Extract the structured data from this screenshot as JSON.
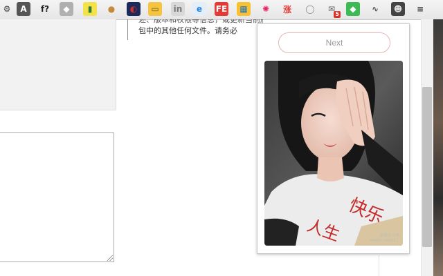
{
  "toolbar": {
    "icons": [
      {
        "name": "gear-icon",
        "glyph": "⚙",
        "color": "#444",
        "bg": "transparent"
      },
      {
        "name": "angular-icon",
        "glyph": "A",
        "color": "#fff",
        "bg": "#555"
      },
      {
        "name": "function-icon",
        "glyph": "f?",
        "color": "#222",
        "bg": "transparent"
      },
      {
        "name": "shield-icon",
        "glyph": "◆",
        "color": "#fff",
        "bg": "#b0b0b0"
      },
      {
        "name": "book-icon",
        "glyph": "▮",
        "color": "#2e7d32",
        "bg": "#f3e24a"
      },
      {
        "name": "cookie-icon",
        "glyph": "●",
        "color": "#c58a3a",
        "bg": "transparent"
      },
      {
        "name": "speedometer-icon",
        "glyph": "◐",
        "color": "#d32f2f",
        "bg": "#1b2a5a"
      },
      {
        "name": "ruler-icon",
        "glyph": "▭",
        "color": "#7a5a00",
        "bg": "#f5c542"
      },
      {
        "name": "linkedin-icon",
        "glyph": "in",
        "color": "#777",
        "bg": "#d8d8d8"
      },
      {
        "name": "clipboard-icon",
        "glyph": "e",
        "color": "#1e88e5",
        "bg": "#e3eef9"
      },
      {
        "name": "fe-icon",
        "glyph": "FE",
        "color": "#fff",
        "bg": "#e53935"
      },
      {
        "name": "grid-icon",
        "glyph": "▦",
        "color": "#1976d2",
        "bg": "#fbc02d"
      },
      {
        "name": "color-wheel-icon",
        "glyph": "✺",
        "color": "#e91e63",
        "bg": "transparent"
      },
      {
        "name": "shopping-icon",
        "glyph": "涨",
        "color": "#e53935",
        "bg": "transparent"
      },
      {
        "name": "circle-icon",
        "glyph": "◯",
        "color": "#888",
        "bg": "transparent"
      },
      {
        "name": "mail-icon",
        "glyph": "✉",
        "color": "#666",
        "bg": "transparent",
        "badge": "5"
      },
      {
        "name": "feedly-icon",
        "glyph": "◆",
        "color": "#fff",
        "bg": "#3cba54"
      },
      {
        "name": "pulse-icon",
        "glyph": "∿",
        "color": "#555",
        "bg": "transparent"
      },
      {
        "name": "avatar-extension-icon",
        "glyph": "☻",
        "color": "#ddd",
        "bg": "#444"
      },
      {
        "name": "menu-icon",
        "glyph": "≡",
        "color": "#444",
        "bg": "transparent"
      }
    ]
  },
  "document": {
    "line_top": "述、版本和权限等信息，或更新当前版本中的代码库",
    "line_main": "包中的其他任何文件。请务必"
  },
  "popup": {
    "next_label": "Next",
    "photo_watermark_line1": "@椰汁小仙",
    "photo_watermark_line2": "weibo.com/1..."
  }
}
